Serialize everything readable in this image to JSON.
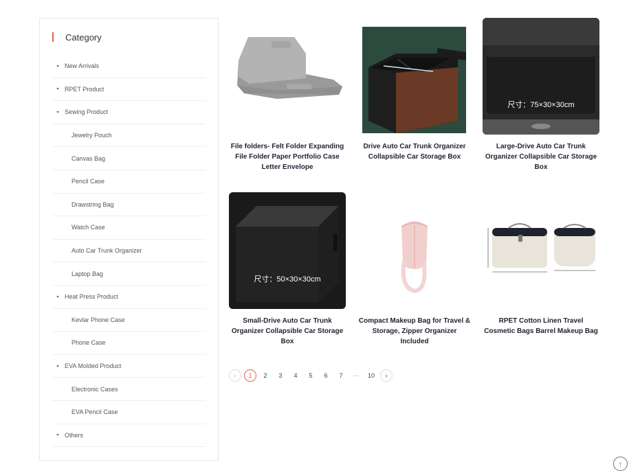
{
  "sidebar": {
    "title": "Category",
    "items": [
      {
        "label": "New Arrivals",
        "type": "parent"
      },
      {
        "label": "RPET Product",
        "type": "parent"
      },
      {
        "label": "Sewing Product",
        "type": "parent"
      },
      {
        "label": "Jewelry Pouch",
        "type": "child"
      },
      {
        "label": "Canvas Bag",
        "type": "child"
      },
      {
        "label": "Pencil Case",
        "type": "child"
      },
      {
        "label": "Drawstring Bag",
        "type": "child"
      },
      {
        "label": "Watch Case",
        "type": "child"
      },
      {
        "label": "Auto Car Trunk Organizer",
        "type": "child"
      },
      {
        "label": "Laptop Bag",
        "type": "child"
      },
      {
        "label": "Heat Press Product",
        "type": "parent"
      },
      {
        "label": "Kevlar Phone Case",
        "type": "child"
      },
      {
        "label": "Phone Case",
        "type": "child"
      },
      {
        "label": "EVA Molded Product",
        "type": "parent"
      },
      {
        "label": "Electronic Cases",
        "type": "child"
      },
      {
        "label": "EVA Pencil Case",
        "type": "child"
      },
      {
        "label": "Others",
        "type": "parent"
      }
    ]
  },
  "products": [
    {
      "name": "File folders- Felt Folder Expanding File Folder Paper Portfolio Case Letter Envelope",
      "caption": ""
    },
    {
      "name": "Drive Auto Car Trunk Organizer Collapsible Car Storage Box",
      "caption": ""
    },
    {
      "name": "Large-Drive Auto Car Trunk Organizer Collapsible Car Storage Box",
      "caption": "尺寸：75×30×30cm"
    },
    {
      "name": "Small-Drive Auto Car Trunk Organizer Collapsible Car Storage Box",
      "caption": "尺寸：50×30×30cm"
    },
    {
      "name": "Compact Makeup Bag for Travel & Storage, Zipper Organizer Included",
      "caption": ""
    },
    {
      "name": "RPET Cotton Linen Travel Cosmetic Bags Barrel Makeup Bag",
      "caption": ""
    }
  ],
  "pagination": {
    "prev": "‹",
    "pages": [
      "1",
      "2",
      "3",
      "4",
      "5",
      "6",
      "7",
      "···",
      "10"
    ],
    "active": "1",
    "next": "›"
  },
  "back_to_top": "↑",
  "colors": {
    "accent": "#e8604c"
  }
}
